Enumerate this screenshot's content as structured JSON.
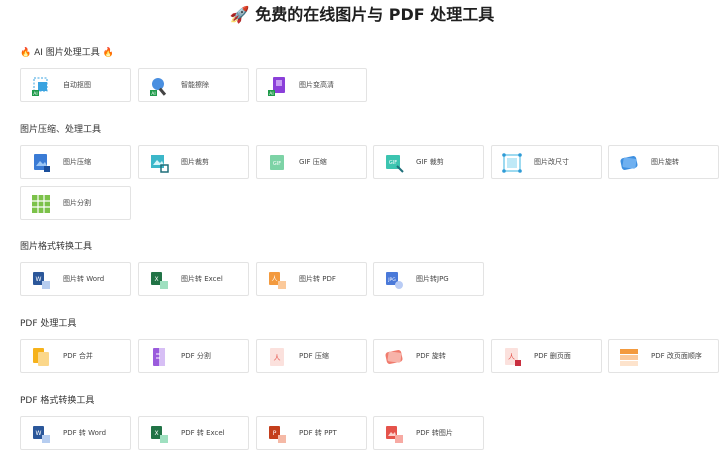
{
  "page": {
    "title": "🚀 免费的在线图片与 PDF 处理工具"
  },
  "sections": [
    {
      "title": "🔥 AI 图片处理工具 🔥",
      "tools": [
        {
          "label": "自动抠图",
          "icon": "auto-cutout-icon"
        },
        {
          "label": "智能擦除",
          "icon": "smart-erase-icon"
        },
        {
          "label": "图片变高清",
          "icon": "image-enhance-icon"
        }
      ]
    },
    {
      "title": "图片压缩、处理工具",
      "tools": [
        {
          "label": "图片压缩",
          "icon": "image-compress-icon"
        },
        {
          "label": "图片裁剪",
          "icon": "image-crop-icon"
        },
        {
          "label": "GIF 压缩",
          "icon": "gif-compress-icon"
        },
        {
          "label": "GIF 裁剪",
          "icon": "gif-crop-icon"
        },
        {
          "label": "图片改尺寸",
          "icon": "image-resize-icon"
        },
        {
          "label": "图片旋转",
          "icon": "image-rotate-icon"
        },
        {
          "label": "图片分割",
          "icon": "image-split-icon"
        }
      ]
    },
    {
      "title": "图片格式转换工具",
      "tools": [
        {
          "label": "图片转 Word",
          "icon": "image-to-word-icon"
        },
        {
          "label": "图片转 Excel",
          "icon": "image-to-excel-icon"
        },
        {
          "label": "图片转 PDF",
          "icon": "image-to-pdf-icon"
        },
        {
          "label": "图片转JPG",
          "icon": "image-to-jpg-icon"
        }
      ]
    },
    {
      "title": "PDF 处理工具",
      "tools": [
        {
          "label": "PDF 合并",
          "icon": "pdf-merge-icon"
        },
        {
          "label": "PDF 分割",
          "icon": "pdf-split-icon"
        },
        {
          "label": "PDF 压缩",
          "icon": "pdf-compress-icon"
        },
        {
          "label": "PDF 旋转",
          "icon": "pdf-rotate-icon"
        },
        {
          "label": "PDF 删页面",
          "icon": "pdf-delete-pages-icon"
        },
        {
          "label": "PDF 改页面顺序",
          "icon": "pdf-reorder-icon"
        }
      ]
    },
    {
      "title": "PDF 格式转换工具",
      "tools": [
        {
          "label": "PDF 转 Word",
          "icon": "pdf-to-word-icon"
        },
        {
          "label": "PDF 转 Excel",
          "icon": "pdf-to-excel-icon"
        },
        {
          "label": "PDF 转 PPT",
          "icon": "pdf-to-ppt-icon"
        },
        {
          "label": "PDF 转图片",
          "icon": "pdf-to-image-icon"
        }
      ]
    }
  ],
  "colors": {
    "word": "#2b579a",
    "excel": "#217346",
    "ppt": "#c43e1c",
    "pdf": "#e5534b",
    "accent": "#2f9bd6"
  }
}
